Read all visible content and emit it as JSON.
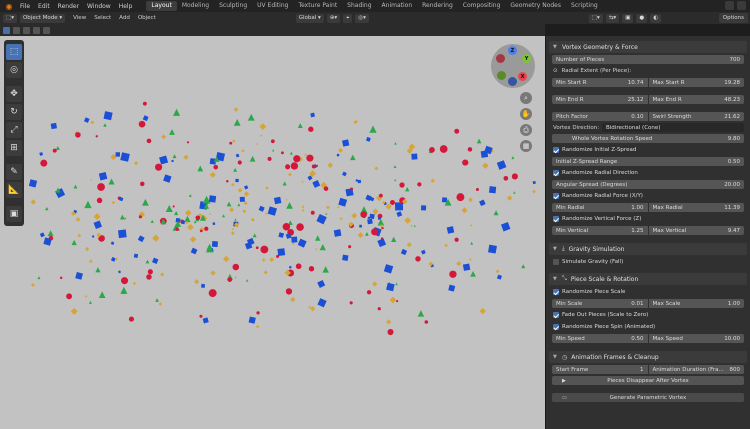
{
  "menubar": {
    "items": [
      "File",
      "Edit",
      "Render",
      "Window",
      "Help"
    ],
    "workspaces": [
      "Layout",
      "Modeling",
      "Sculpting",
      "UV Editing",
      "Texture Paint",
      "Shading",
      "Animation",
      "Rendering",
      "Compositing",
      "Geometry Nodes",
      "Scripting"
    ],
    "active_workspace": "Layout"
  },
  "header": {
    "mode": "Object Mode",
    "menus": [
      "View",
      "Select",
      "Add",
      "Object"
    ],
    "transform_orientation": "Global",
    "options_label": "Options"
  },
  "panel": {
    "main_section": "Vortex Geometry & Force",
    "number_of_pieces": {
      "label": "Number of Pieces",
      "value": "700"
    },
    "radial_extent_label": "Radial Extent (Per Piece):",
    "min_start_r": {
      "label": "Min Start R",
      "value": "10.74"
    },
    "max_start_r": {
      "label": "Max Start R",
      "value": "19.28"
    },
    "min_end_r": {
      "label": "Min End R",
      "value": "25.12"
    },
    "max_end_r": {
      "label": "Max End R",
      "value": "48.23"
    },
    "pitch_factor": {
      "label": "Pitch Factor",
      "value": "0.10"
    },
    "swirl_strength": {
      "label": "Swirl Strength",
      "value": "21.62"
    },
    "vortex_direction": {
      "label": "Vortex Direction:",
      "value": "Bidirectional (Cone)"
    },
    "whole_rotation_speed": {
      "label": "Whole Vortex Rotation Speed",
      "value": "9.80"
    },
    "rand_initial_z": "Randomize Initial Z-Spread",
    "initial_z_range": {
      "label": "Initial Z-Spread Range",
      "value": "0.50"
    },
    "rand_radial_dir": "Randomize Radial Direction",
    "angular_spread": {
      "label": "Angular Spread (Degrees)",
      "value": "20.00"
    },
    "rand_radial_force": "Randomize Radial Force (X/Y)",
    "min_radial": {
      "label": "Min Radial",
      "value": "1.00"
    },
    "max_radial": {
      "label": "Max Radial",
      "value": "11.39"
    },
    "rand_vertical_force": "Randomize Vertical Force (Z)",
    "min_vertical": {
      "label": "Min Vertical",
      "value": "1.25"
    },
    "max_vertical": {
      "label": "Max Vertical",
      "value": "9.47"
    },
    "gravity_section": "Gravity Simulation",
    "simulate_gravity": "Simulate Gravity (Fall)",
    "scale_section": "Piece Scale & Rotation",
    "rand_piece_scale": "Randomize Piece Scale",
    "min_scale": {
      "label": "Min Scale",
      "value": "0.01"
    },
    "max_scale": {
      "label": "Max Scale",
      "value": "1.00"
    },
    "fade_out": "Fade Out Pieces (Scale to Zero)",
    "rand_piece_spin": "Randomize Piece Spin (Animated)",
    "min_speed": {
      "label": "Min Speed",
      "value": "0.50"
    },
    "max_speed": {
      "label": "Max Speed",
      "value": "10.00"
    },
    "anim_section": "Animation Frames & Cleanup",
    "start_frame": {
      "label": "Start Frame",
      "value": "1"
    },
    "anim_duration": {
      "label": "Animation Duration (Fra...",
      "value": "800"
    },
    "pieces_disappear": "Pieces Disappear After Vortex",
    "generate_button": "Generate Parametric Vortex"
  },
  "gizmo": {
    "x": "X",
    "y": "Y",
    "z": "Z"
  },
  "colors": {
    "accent": "#4772b3",
    "cube": "#1a4fd6",
    "sphere": "#d4183a",
    "cone": "#2aa84a",
    "ico": "#d6a53a"
  }
}
